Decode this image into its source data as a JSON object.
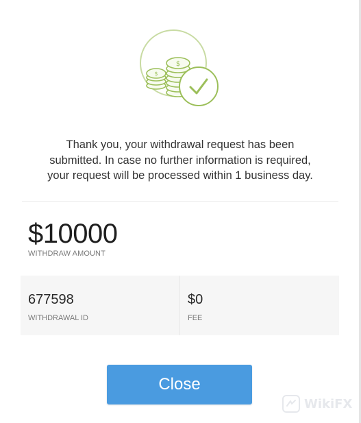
{
  "message": {
    "line1": "Thank you, your withdrawal request has been",
    "line2": "submitted. In case no further information is required,",
    "line3": "your request will be processed within 1 business day."
  },
  "withdraw": {
    "amount": "$10000",
    "amount_label": "WITHDRAW AMOUNT",
    "id_value": "677598",
    "id_label": "WITHDRAWAL ID",
    "fee_value": "$0",
    "fee_label": "FEE"
  },
  "actions": {
    "close_label": "Close"
  },
  "watermark": {
    "text": "WikiFX"
  },
  "icons": {
    "hero": "coins-checkmark-icon",
    "watermark": "wikifx-logo-icon"
  },
  "colors": {
    "accent": "#4a9be0",
    "icon_green": "#9cbf5a",
    "text": "#333333",
    "muted": "#7a7a7a"
  }
}
